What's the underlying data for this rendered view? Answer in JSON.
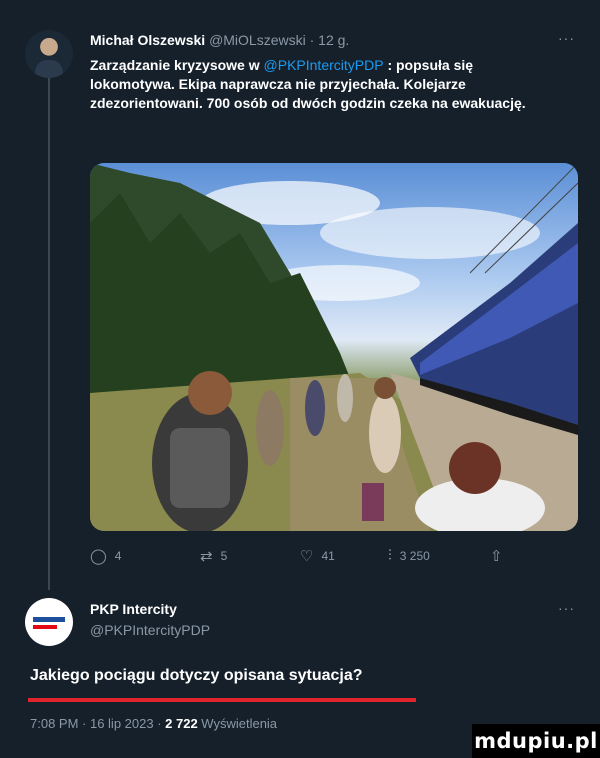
{
  "tweet1": {
    "author_name": "Michał Olszewski",
    "author_handle": "@MiOLszewski",
    "time": "· 12 g.",
    "text_1": "Zarządzanie kryzysowe w ",
    "mention": "@PKPIntercityPDP",
    "text_2": " : popsuła się lokomotywa. Ekipa naprawcza nie przyjechała. Kolejarze zdezorientowani. 700 osób od dwóch godzin czeka na ewakuację.",
    "more_icon": "more-dots-icon",
    "actions": {
      "reply_count": "4",
      "retweet_count": "5",
      "like_count": "41",
      "views_count": "3 250"
    }
  },
  "tweet2": {
    "author_name": "PKP Intercity",
    "author_handle": "@PKPIntercityPDP",
    "text": "Jakiego pociągu dotyczy opisana sytuacja?",
    "meta_time": "7:08 PM · 16 lip 2023 · ",
    "views_number": "2 722",
    "views_label": " Wyświetlenia"
  },
  "watermark": "mdupiu.pl",
  "colors": {
    "background": "#15202b",
    "accent": "#1d9bf0",
    "underline": "#e0242b",
    "muted": "#8b98a5"
  }
}
